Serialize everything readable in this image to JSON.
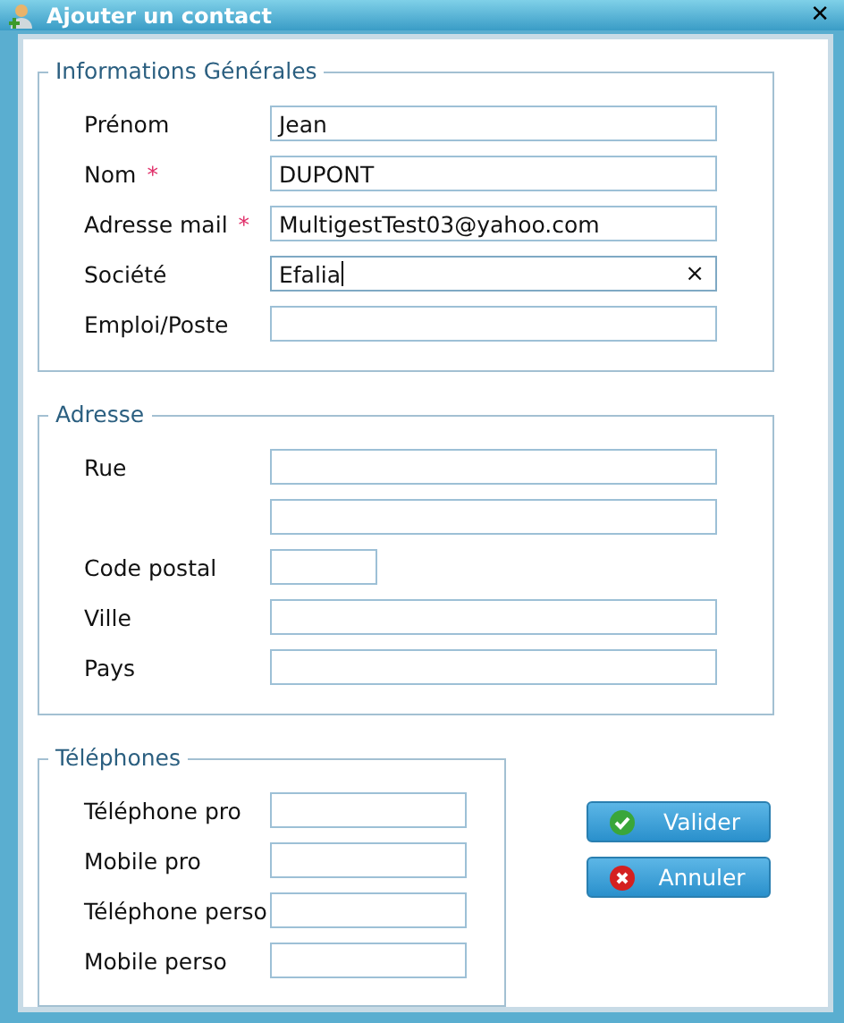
{
  "window": {
    "title": "Ajouter un contact",
    "close": "✕"
  },
  "sections": [
    {
      "legend": "Informations Générales",
      "fields": [
        {
          "label": "Prénom",
          "value": "Jean",
          "kind": "wide",
          "focused": false
        },
        {
          "label": "Nom",
          "required_mark": "*",
          "value": "DUPONT",
          "kind": "wide",
          "focused": false
        },
        {
          "label": "Adresse mail",
          "required_mark": "*",
          "value": "MultigestTest03@yahoo.com",
          "kind": "wide",
          "focused": false
        },
        {
          "label": "Société",
          "value": "Efalia",
          "kind": "wide",
          "focused": true,
          "clear": "×"
        },
        {
          "label": "Emploi/Poste",
          "kind": "wide",
          "focused": false
        }
      ]
    },
    {
      "legend": "Adresse",
      "fields": [
        {
          "label": "Rue",
          "kind": "wide",
          "focused": false
        },
        {
          "kind": "wide",
          "focused": false
        },
        {
          "label": "Code postal",
          "kind": "short",
          "focused": false
        },
        {
          "label": "Ville",
          "kind": "wide",
          "focused": false
        },
        {
          "label": "Pays",
          "kind": "wide",
          "focused": false
        }
      ]
    },
    {
      "legend": "Téléphones",
      "fields": [
        {
          "label": "Téléphone pro",
          "kind": "medium",
          "focused": false
        },
        {
          "label": "Mobile pro",
          "kind": "medium",
          "focused": false
        },
        {
          "label": "Téléphone perso",
          "kind": "medium",
          "focused": false
        },
        {
          "label": "Mobile perso",
          "kind": "medium",
          "focused": false
        }
      ]
    }
  ],
  "buttons": [
    {
      "label": "Valider",
      "kind": "ok"
    },
    {
      "label": "Annuler",
      "kind": "cancel"
    }
  ]
}
